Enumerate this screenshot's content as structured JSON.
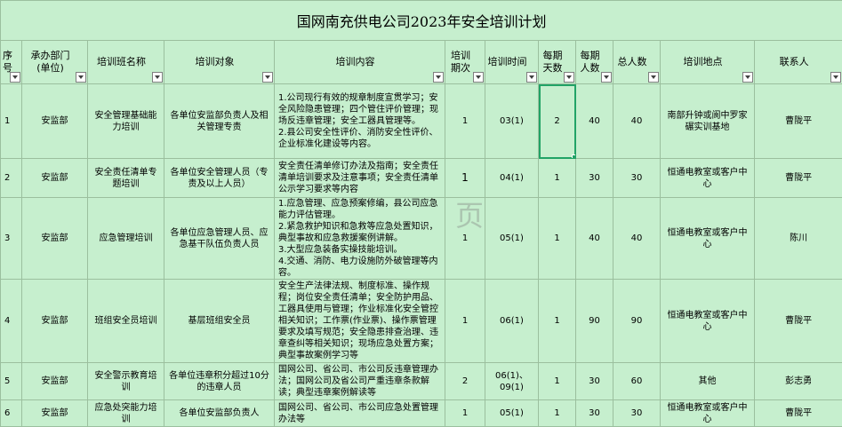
{
  "title": "国网南充供电公司2023年安全培训计划",
  "headers": [
    "序号",
    "承办部门(单位)",
    "培训班名称",
    "培训对象",
    "培训内容",
    "培训期次",
    "培训时间",
    "每期天数",
    "每期人数",
    "总人数",
    "培训地点",
    "联系人"
  ],
  "rows": [
    {
      "no": "1",
      "dept": "安监部",
      "name": "安全管理基础能力培训",
      "target": "各单位安监部负责人及相关管理专责",
      "content": "1.公司现行有效的规章制度宣贯学习；安全风险隐患管理；四个管住评价管理；现场反违章管理；安全工器具管理等。\n2.县公司安全性评价、消防安全性评价、企业标准化建设等内容。",
      "sessions": "1",
      "time": "03(1)",
      "days": "2",
      "people": "40",
      "total": "40",
      "place": "南部升钟或阆中罗家碾实训基地",
      "contact": "曹陇平"
    },
    {
      "no": "2",
      "dept": "安监部",
      "name": "安全责任清单专题培训",
      "target": "各单位安全管理人员（专责及以上人员）",
      "content": "安全责任清单修订办法及指南；安全责任清单培训要求及注意事项；安全责任清单公示学习要求等内容",
      "sessions": "1",
      "time": "04(1)",
      "days": "1",
      "people": "30",
      "total": "30",
      "place": "恒通电教室或客户中心",
      "contact": "曹陇平"
    },
    {
      "no": "3",
      "dept": "安监部",
      "name": "应急管理培训",
      "target": "各单位应急管理人员、应急基干队伍负责人员",
      "content": "1.应急管理、应急预案修编，县公司应急能力评估管理。\n2.紧急救护知识和急救等应急处置知识，典型事故和应急救援案例讲解。\n3.大型应急装备实操技能培训。\n4.交通、消防、电力设施防外破管理等内容。",
      "sessions": "1",
      "time": "05(1)",
      "days": "1",
      "people": "40",
      "total": "40",
      "place": "恒通电教室或客户中心",
      "contact": "陈川"
    },
    {
      "no": "4",
      "dept": "安监部",
      "name": "班组安全员培训",
      "target": "基层班组安全员",
      "content": "安全生产法律法规、制度标准、操作规程；岗位安全责任清单；安全防护用品、工器具使用与管理；作业标准化安全管控相关知识；工作票(作业票)、操作票管理要求及填写规范；安全隐患排查治理、违章查纠等相关知识；现场应急处置方案；典型事故案例学习等",
      "sessions": "1",
      "time": "06(1)",
      "days": "1",
      "people": "90",
      "total": "90",
      "place": "恒通电教室或客户中心",
      "contact": "曹陇平"
    },
    {
      "no": "5",
      "dept": "安监部",
      "name": "安全警示教育培训",
      "target": "各单位违章积分超过10分的违章人员",
      "content": "国网公司、省公司、市公司反违章管理办法；国网公司及省公司严重违章条款解读；典型违章案例解读等",
      "sessions": "2",
      "time": "06(1)、09(1)",
      "days": "1",
      "people": "30",
      "total": "60",
      "place": "其他",
      "contact": "彭志勇"
    },
    {
      "no": "6",
      "dept": "安监部",
      "name": "应急处突能力培训",
      "target": "各单位安监部负责人",
      "content": "国网公司、省公司、市公司应急处置管理办法等",
      "sessions": "1",
      "time": "05(1)",
      "days": "1",
      "people": "30",
      "total": "30",
      "place": "恒通电教室或客户中心",
      "contact": "曹陇平"
    }
  ],
  "watermark": "页",
  "accent_color": "#21a366",
  "cell_bg": "#c6efce"
}
